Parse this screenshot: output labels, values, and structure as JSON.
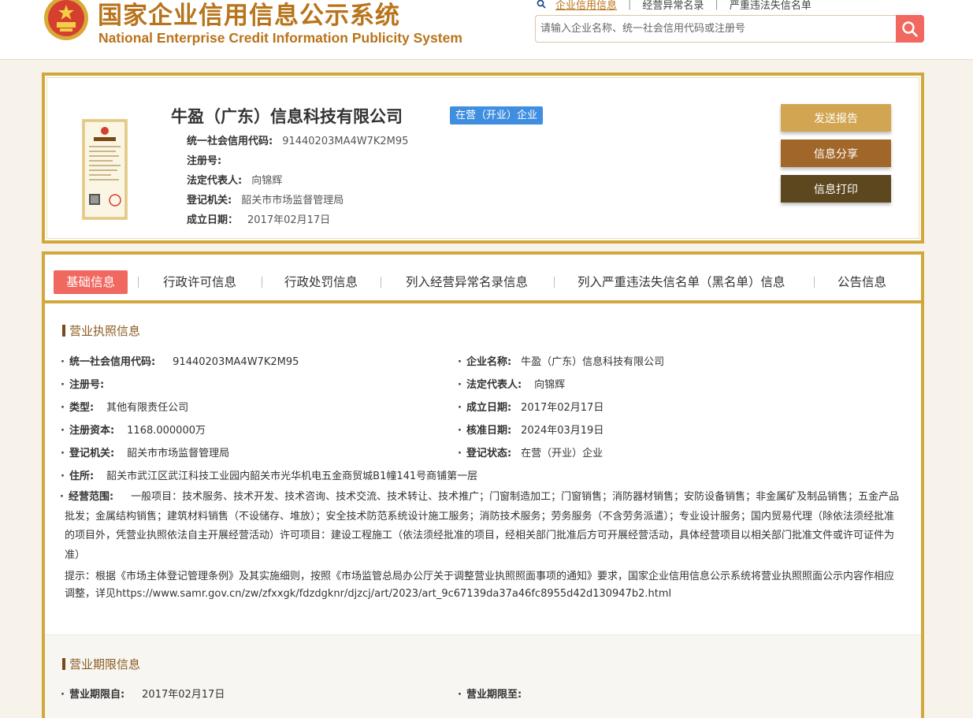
{
  "header": {
    "title_cn": "国家企业信用信息公示系统",
    "title_en": "National Enterprise Credit Information Publicity System",
    "links": [
      "企业信用信息",
      "经营异常名录",
      "严重违法失信名单"
    ],
    "search_placeholder": "请输入企业名称、统一社会信用代码或注册号"
  },
  "company": {
    "name": "牛盈（广东）信息科技有限公司",
    "status": "在营（开业）企业",
    "rows": [
      {
        "label": "统一社会信用代码:",
        "value": "91440203MA4W7K2M95"
      },
      {
        "label": "注册号:",
        "value": ""
      },
      {
        "label": "法定代表人:",
        "value": "向锦辉"
      },
      {
        "label": "登记机关:",
        "value": "韶关市市场监督管理局"
      },
      {
        "label": "成立日期：",
        "value": "2017年02月17日"
      }
    ],
    "buttons": {
      "report": "发送报告",
      "share": "信息分享",
      "print": "信息打印"
    }
  },
  "tabs": [
    "基础信息",
    "行政许可信息",
    "行政处罚信息",
    "列入经营异常名录信息",
    "列入严重违法失信名单（黑名单）信息",
    "公告信息"
  ],
  "license": {
    "title": "营业执照信息",
    "fields_left": [
      {
        "label": "统一社会信用代码:",
        "value": "91440203MA4W7K2M95"
      },
      {
        "label": "注册号:",
        "value": ""
      },
      {
        "label": "类型:",
        "value": "其他有限责任公司"
      },
      {
        "label": "注册资本:",
        "value": "1168.000000万"
      },
      {
        "label": "登记机关:",
        "value": "韶关市市场监督管理局"
      }
    ],
    "fields_right": [
      {
        "label": "企业名称:",
        "value": "牛盈（广东）信息科技有限公司"
      },
      {
        "label": "法定代表人:",
        "value": "向锦辉"
      },
      {
        "label": "成立日期:",
        "value": "2017年02月17日"
      },
      {
        "label": "核准日期:",
        "value": "2024年03月19日"
      },
      {
        "label": "登记状态:",
        "value": "在营（开业）企业"
      }
    ],
    "address": {
      "label": "住所:",
      "value": "韶关市武江区武江科技工业园内韶关市光华机电五金商贸城B1幢141号商铺第一层"
    },
    "scope": {
      "label": "经营范围:",
      "value": "一般项目：技术服务、技术开发、技术咨询、技术交流、技术转让、技术推广；门窗制造加工；门窗销售；消防器材销售；安防设备销售；非金属矿及制品销售；五金产品批发；金属结构销售；建筑材料销售（不设储存、堆放）；安全技术防范系统设计施工服务；消防技术服务；劳务服务（不含劳务派遣）；专业设计服务；国内贸易代理（除依法须经批准的项目外，凭营业执照依法自主开展经营活动）许可项目：建设工程施工（依法须经批准的项目，经相关部门批准后方可开展经营活动，具体经营项目以相关部门批准文件或许可证件为准）"
    },
    "tip": "提示：根据《市场主体登记管理条例》及其实施细则，按照《市场监管总局办公厅关于调整营业执照照面事项的通知》要求，国家企业信用信息公示系统将营业执照照面公示内容作相应调整，详见https://www.samr.gov.cn/zw/zfxxgk/fdzdgknr/djzcj/art/2023/art_9c67139da37a46fc8955d42d130947b2.html"
  },
  "term": {
    "title": "营业期限信息",
    "from": {
      "label": "营业期限自:",
      "value": "2017年02月17日"
    },
    "to": {
      "label": "营业期限至:",
      "value": ""
    }
  }
}
